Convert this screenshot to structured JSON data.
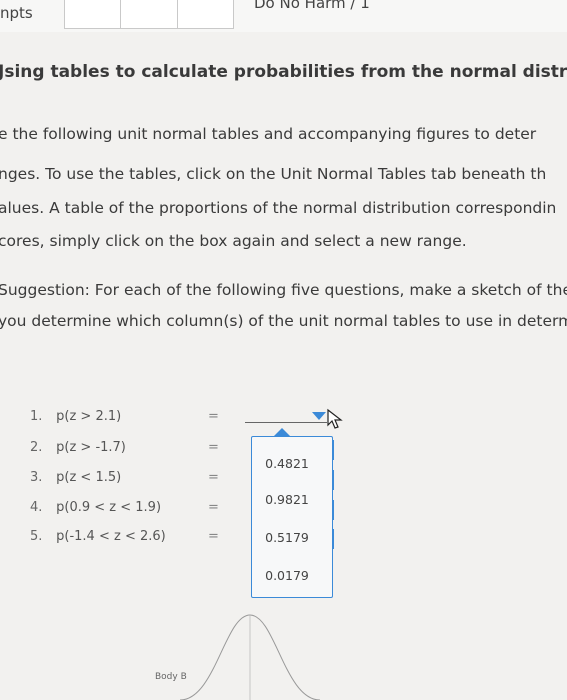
{
  "header": {
    "pts_label": "npts",
    "attempt_boxes": 3,
    "document_title": "Do No Harm / 1"
  },
  "section_title": "Jsing tables to calculate probabilities from the normal distrib",
  "instructions": [
    "e the following unit normal tables and accompanying figures to deter",
    "nges. To use the tables, click on the Unit Normal Tables tab beneath th",
    "alues. A table of the proportions of the normal distribution correspondin",
    "cores, simply click on the box again and select a new range."
  ],
  "suggestion": [
    "Suggestion: For each of the following five questions, make a sketch of the",
    "you determine which column(s) of the unit normal tables to use in determ"
  ],
  "questions": [
    {
      "num": "1.",
      "expr": "p(z > 2.1)",
      "eq": "="
    },
    {
      "num": "2.",
      "expr": "p(z > -1.7)",
      "eq": "="
    },
    {
      "num": "3.",
      "expr": "p(z < 1.5)",
      "eq": "="
    },
    {
      "num": "4.",
      "expr": "p(0.9 < z < 1.9)",
      "eq": "="
    },
    {
      "num": "5.",
      "expr": "p(-1.4 < z < 2.6)",
      "eq": "="
    }
  ],
  "answer_dropdown": {
    "selected_value": "",
    "options": [
      "0.4821",
      "0.9821",
      "0.5179",
      "0.0179"
    ],
    "accent_color": "#3b8ad8"
  },
  "figure": {
    "label": "Body B"
  }
}
